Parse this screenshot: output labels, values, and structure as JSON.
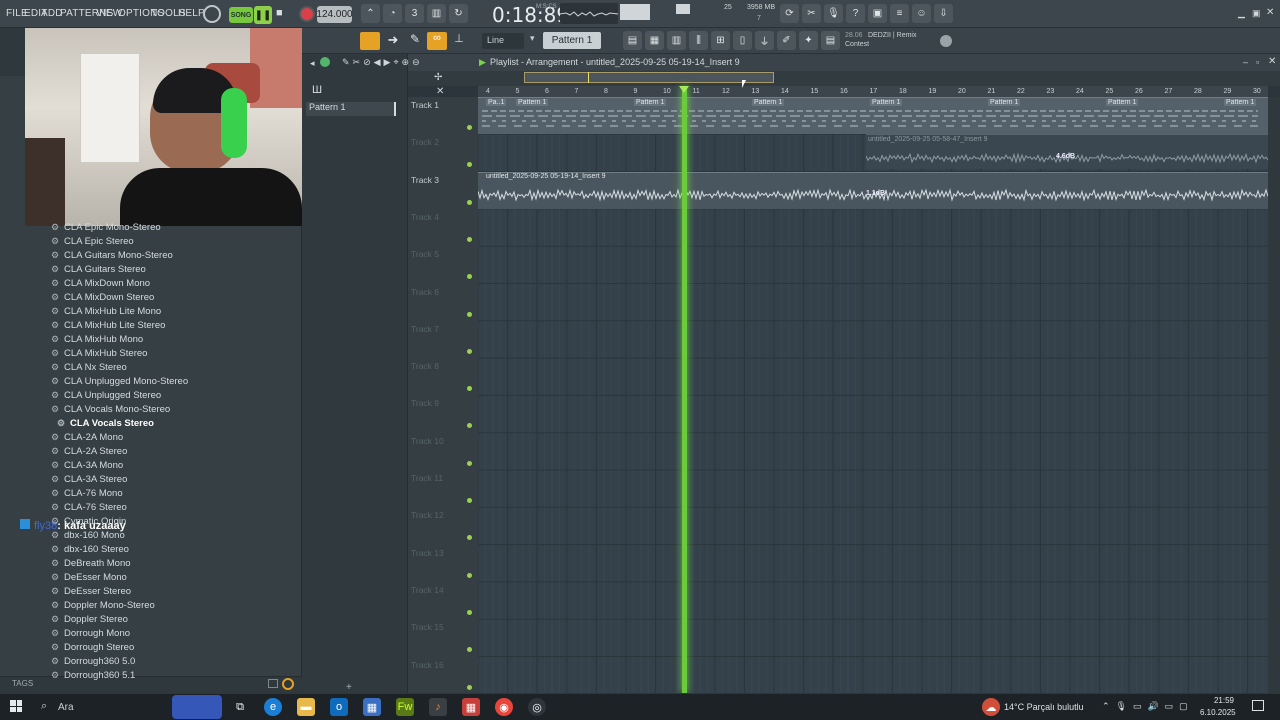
{
  "menu": {
    "items": [
      "FILE",
      "EDIT",
      "ADD",
      "PATTERNS",
      "VIEW",
      "OPTIONS",
      "TOOLS",
      "HELP"
    ]
  },
  "transport": {
    "song_label": "SONG",
    "tempo": "124.000",
    "time": "0:18:89",
    "time_sub": "M:S:CS",
    "mem": "3958 MB",
    "mem_small": "25",
    "mem_sub": "7"
  },
  "toolbar2": {
    "snap": "Line",
    "pattern": "Pattern 1",
    "hint_num": "28.06",
    "hint_title": "DEDZII | Remix",
    "hint_sub": "Contest"
  },
  "browser": {
    "items": [
      "CLA Epic Mono-Stereo",
      "CLA Epic Stereo",
      "CLA Guitars Mono-Stereo",
      "CLA Guitars Stereo",
      "CLA MixDown Mono",
      "CLA MixDown Stereo",
      "CLA MixHub Lite Mono",
      "CLA MixHub Lite Stereo",
      "CLA MixHub Mono",
      "CLA MixHub Stereo",
      "CLA Nx Stereo",
      "CLA Unplugged Mono-Stereo",
      "CLA Unplugged Stereo",
      "CLA Vocals Mono-Stereo",
      "CLA Vocals Stereo",
      "CLA-2A Mono",
      "CLA-2A Stereo",
      "CLA-3A Mono",
      "CLA-3A Stereo",
      "CLA-76 Mono",
      "CLA-76 Stereo",
      "Cymatic Origin",
      "dbx-160 Mono",
      "dbx-160 Stereo",
      "DeBreath Mono",
      "DeEsser Mono",
      "DeEsser Stereo",
      "Doppler Mono-Stereo",
      "Doppler Stereo",
      "Dorrough Mono",
      "Dorrough Stereo",
      "Dorrough360 5.0",
      "Dorrough360 5.1"
    ],
    "selected": "CLA Vocals Stereo",
    "tags_label": "TAGS"
  },
  "chat": {
    "user": "fly38",
    "message": ": kafa uzaaay"
  },
  "patterns": {
    "item": "Pattern 1"
  },
  "playlist": {
    "title": "Playlist - Arrangement - untitled_2025-09-25 05-19-14_Insert 9",
    "ruler": [
      "4",
      "5",
      "6",
      "7",
      "8",
      "9",
      "10",
      "11",
      "12",
      "13",
      "14",
      "15",
      "16",
      "17",
      "18",
      "19",
      "20",
      "21",
      "22",
      "23",
      "24",
      "25",
      "26",
      "27",
      "28",
      "29",
      "30"
    ],
    "tracks": [
      "Track 1",
      "Track 2",
      "Track 3",
      "Track 4",
      "Track 5",
      "Track 6",
      "Track 7",
      "Track 8",
      "Track 9",
      "Track 10",
      "Track 11",
      "Track 12",
      "Track 13",
      "Track 14",
      "Track 15",
      "Track 16"
    ],
    "clip_pattern": "Pattern 1",
    "clip_pattern_short": "Pa..1",
    "clip_audio1": "untitled_2025-09-25 05-58-47_Insert 9",
    "clip_audio3": "untitled_2025-09-25 05-19-14_Insert 9",
    "db1": "4.6dB",
    "db2": "1.1dB"
  },
  "taskbar": {
    "search": "Ara",
    "weather": "14°C  Parçalı bulutlu",
    "time": "21:59",
    "date": "6.10.2025"
  }
}
